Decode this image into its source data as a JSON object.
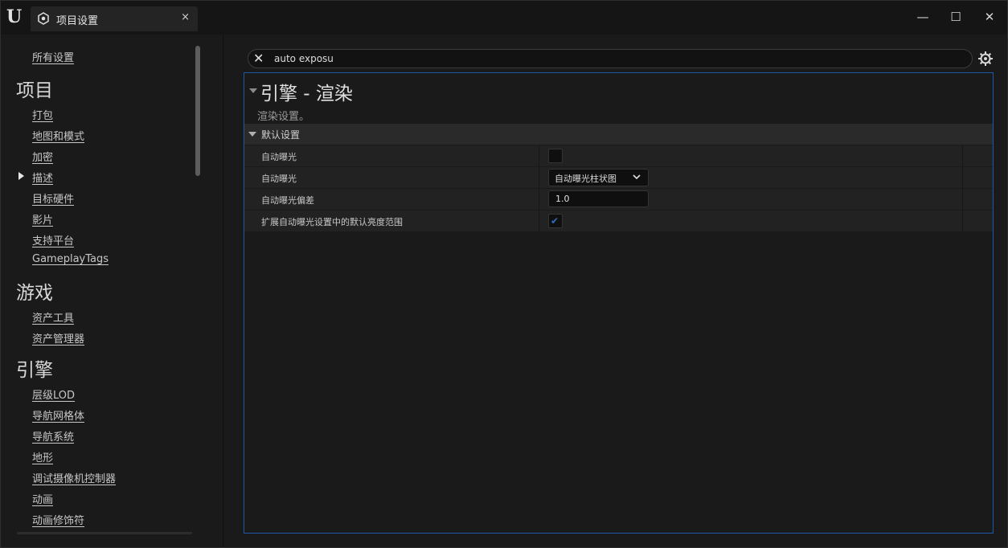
{
  "window": {
    "tab_title": "项目设置",
    "tab_close": "×",
    "minimize": "—",
    "maximize": "☐",
    "close": "✕",
    "logo": "U"
  },
  "sidebar": {
    "all_settings": "所有设置",
    "groups": [
      {
        "title": "项目",
        "items": [
          "打包",
          "地图和模式",
          "加密",
          "描述",
          "目标硬件",
          "影片",
          "支持平台",
          "GameplayTags"
        ]
      },
      {
        "title": "游戏",
        "items": [
          "资产工具",
          "资产管理器"
        ]
      },
      {
        "title": "引擎",
        "items": [
          "层级LOD",
          "导航网格体",
          "导航系统",
          "地形",
          "调试摄像机控制器",
          "动画",
          "动画修饰符"
        ]
      }
    ],
    "selected_item": "描述"
  },
  "search": {
    "value": "auto exposu",
    "clear_icon": "close-icon"
  },
  "settings_icon": "gear-icon",
  "category": {
    "title": "引擎 - 渲染",
    "description": "渲染设置。"
  },
  "section": {
    "title": "默认设置"
  },
  "properties": [
    {
      "label": "自动曝光",
      "type": "checkbox",
      "checked": false
    },
    {
      "label": "自动曝光",
      "type": "dropdown",
      "value": "自动曝光柱状图"
    },
    {
      "label": "自动曝光偏差",
      "type": "number",
      "value": "1.0"
    },
    {
      "label": "扩展自动曝光设置中的默认亮度范围",
      "type": "checkbox",
      "checked": true
    }
  ],
  "colors": {
    "accent": "#1c5aa8",
    "check": "#2f6fbf",
    "background": "#1a1a1a"
  }
}
